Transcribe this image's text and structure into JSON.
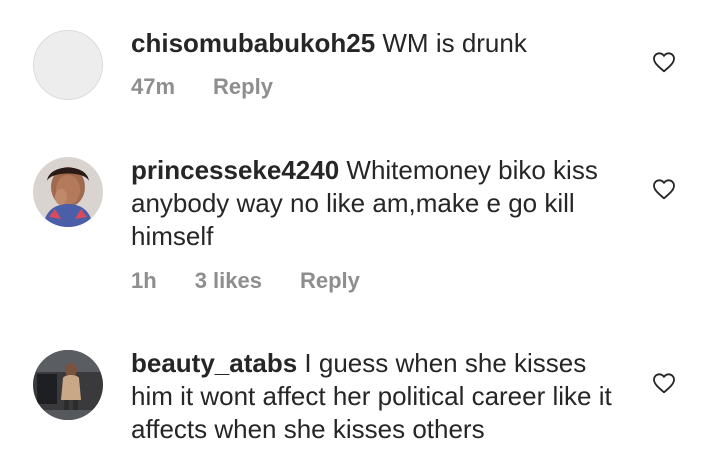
{
  "comments": [
    {
      "username": "chisomubabukoh25",
      "text": "WM is drunk",
      "time": "47m",
      "likes": "",
      "reply": "Reply",
      "avatar": "default-avatar"
    },
    {
      "username": "princesseke4240",
      "text": "Whitemoney biko kiss anybody way no like am,make e go kill himself",
      "time": "1h",
      "likes": "3 likes",
      "reply": "Reply",
      "avatar": "profile-photo"
    },
    {
      "username": "beauty_atabs",
      "text": "I guess when she kisses him it wont affect her political career like it affects when she kisses others",
      "time": "",
      "likes": "",
      "reply": "",
      "avatar": "profile-photo"
    }
  ],
  "icons": {
    "like": "heart-outline-icon"
  },
  "colors": {
    "text": "#262626",
    "meta": "#8e8e8e"
  }
}
